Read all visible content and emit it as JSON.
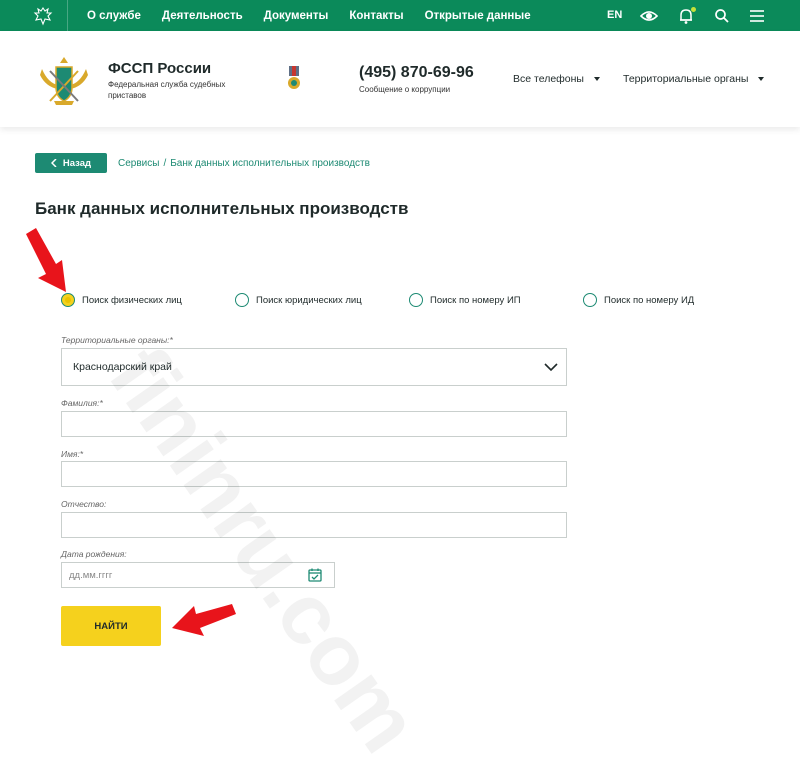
{
  "topnav": {
    "items": [
      "О службе",
      "Деятельность",
      "Документы",
      "Контакты",
      "Открытые данные"
    ],
    "lang": "EN"
  },
  "header": {
    "org_name": "ФССП России",
    "org_sub": "Федеральная служба судебных приставов",
    "phone": "(495) 870-69-96",
    "corruption": "Сообщение о коррупции",
    "all_phones": "Все телефоны",
    "territorial": "Территориальные органы"
  },
  "breadcrumb": {
    "back": "Назад",
    "services": "Сервисы",
    "separator": "/",
    "current": "Банк данных исполнительных производств"
  },
  "page_title": "Банк данных исполнительных производств",
  "search_types": [
    {
      "label": "Поиск физических лиц",
      "checked": true
    },
    {
      "label": "Поиск юридических лиц",
      "checked": false
    },
    {
      "label": "Поиск по номеру ИП",
      "checked": false
    },
    {
      "label": "Поиск по номеру ИД",
      "checked": false
    }
  ],
  "form": {
    "territorial_label": "Территориальные органы:*",
    "territorial_value": "Краснодарский край",
    "surname_label": "Фамилия:*",
    "surname_value": "",
    "name_label": "Имя:*",
    "name_value": "",
    "patronymic_label": "Отчество:",
    "patronymic_value": "",
    "birthdate_label": "Дата рождения:",
    "birthdate_placeholder": "дд.мм.гггг",
    "submit": "НАЙТИ"
  },
  "watermark": "fininru.com",
  "colors": {
    "topbar": "#0b8a5a",
    "accent": "#1d8a73",
    "button": "#f5d11d",
    "arrow": "#e8141b"
  }
}
